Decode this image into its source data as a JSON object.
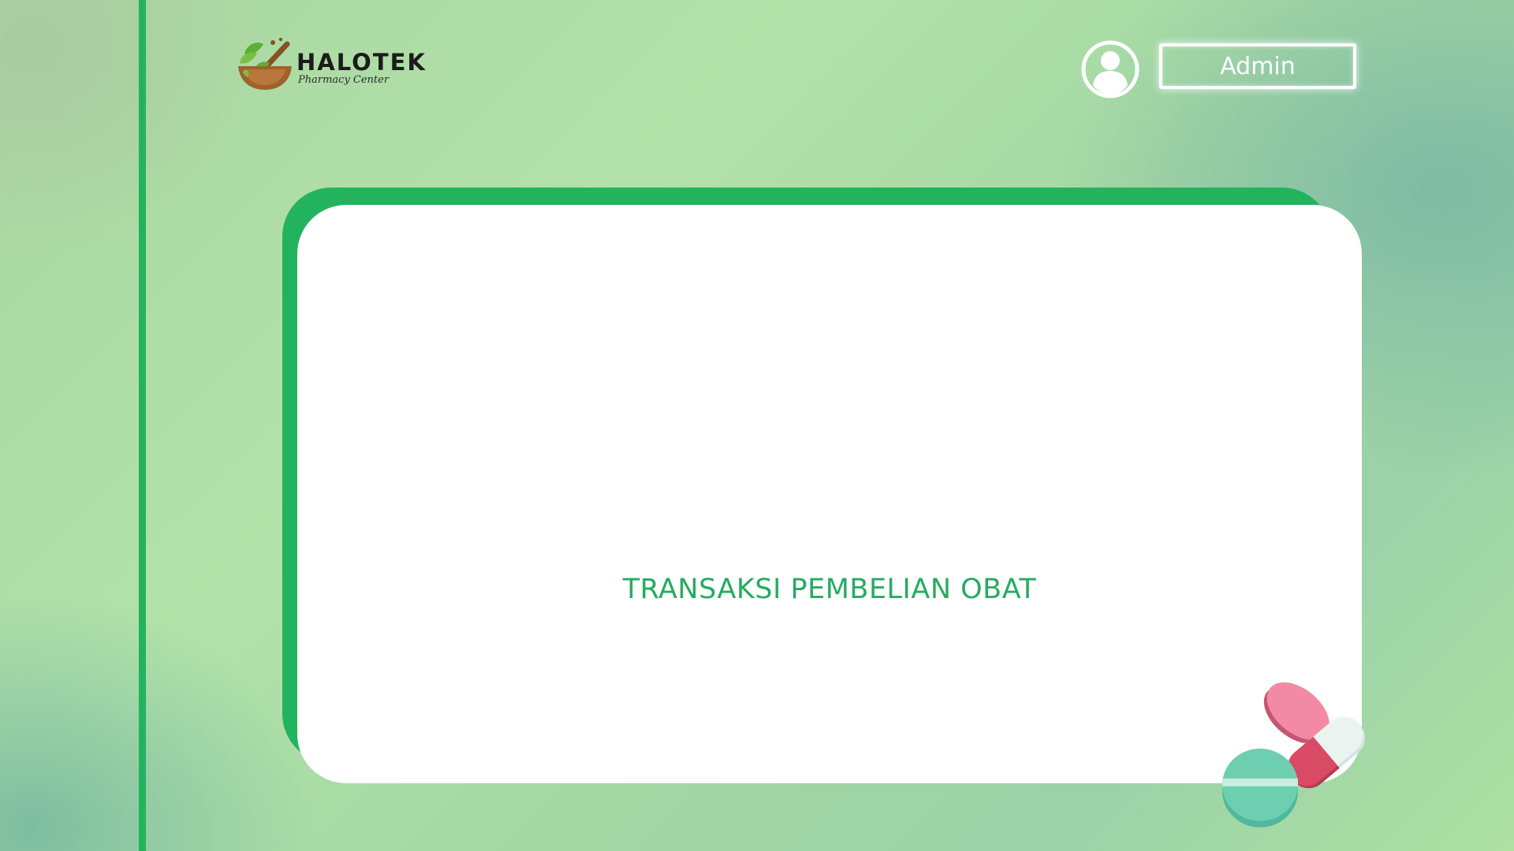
{
  "brand": {
    "name": "HALOTEK",
    "tagline": "Pharmacy Center"
  },
  "header": {
    "user_icon": "user-circle-icon",
    "admin_label": "Admin"
  },
  "main": {
    "card_title": "TRANSAKSI PEMBELIAN OBAT"
  },
  "decor": {
    "pills_icon": "pills-illustration-icon"
  },
  "colors": {
    "accent_green": "#23b35e",
    "title_green": "#27ab62",
    "card_bg": "#ffffff",
    "admin_border": "#ffffff"
  }
}
